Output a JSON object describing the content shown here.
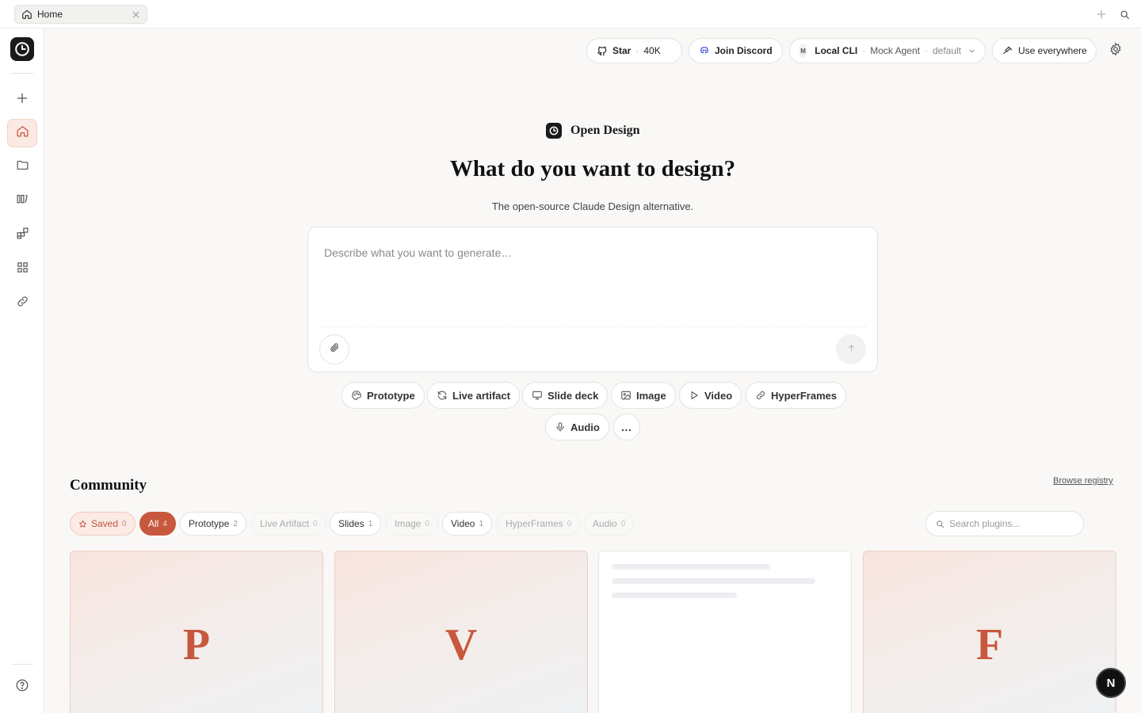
{
  "tabbar": {
    "tab_label": "Home"
  },
  "header": {
    "star_label": "Star",
    "star_count": "40K",
    "discord_label": "Join Discord",
    "agent_source": "Local CLI",
    "agent_name": "Mock Agent",
    "agent_profile": "default",
    "agent_badge": "M",
    "use_everywhere_label": "Use everywhere"
  },
  "hero": {
    "brand_name": "Open Design",
    "title": "What do you want to design?",
    "subtitle": "The open-source Claude Design alternative."
  },
  "composer": {
    "placeholder": "Describe what you want to generate…",
    "value": ""
  },
  "modes": [
    {
      "label": "Prototype",
      "icon": "palette-icon"
    },
    {
      "label": "Live artifact",
      "icon": "refresh-icon"
    },
    {
      "label": "Slide deck",
      "icon": "monitor-icon"
    },
    {
      "label": "Image",
      "icon": "image-icon"
    },
    {
      "label": "Video",
      "icon": "play-icon"
    },
    {
      "label": "HyperFrames",
      "icon": "link-icon"
    },
    {
      "label": "Audio",
      "icon": "mic-icon"
    },
    {
      "label": "…",
      "icon": "more-icon"
    }
  ],
  "community": {
    "title": "Community",
    "browse_label": "Browse registry",
    "search_placeholder": "Search plugins...",
    "filters": [
      {
        "label": "Saved",
        "count": "0",
        "state": "saved"
      },
      {
        "label": "All",
        "count": "4",
        "state": "active"
      },
      {
        "label": "Prototype",
        "count": "2",
        "state": "normal"
      },
      {
        "label": "Live Artifact",
        "count": "0",
        "state": "dim"
      },
      {
        "label": "Slides",
        "count": "1",
        "state": "normal"
      },
      {
        "label": "Image",
        "count": "0",
        "state": "dim"
      },
      {
        "label": "Video",
        "count": "1",
        "state": "normal"
      },
      {
        "label": "HyperFrames",
        "count": "0",
        "state": "dim"
      },
      {
        "label": "Audio",
        "count": "0",
        "state": "dim"
      }
    ],
    "cards": [
      {
        "letter": "P"
      },
      {
        "letter": "V"
      },
      {
        "letter": ""
      },
      {
        "letter": "F"
      }
    ]
  },
  "misc": {
    "n_badge": "N"
  },
  "colors": {
    "accent": "#c7573d",
    "accent_soft": "#fbe9e3",
    "background": "#f9f8f6"
  }
}
